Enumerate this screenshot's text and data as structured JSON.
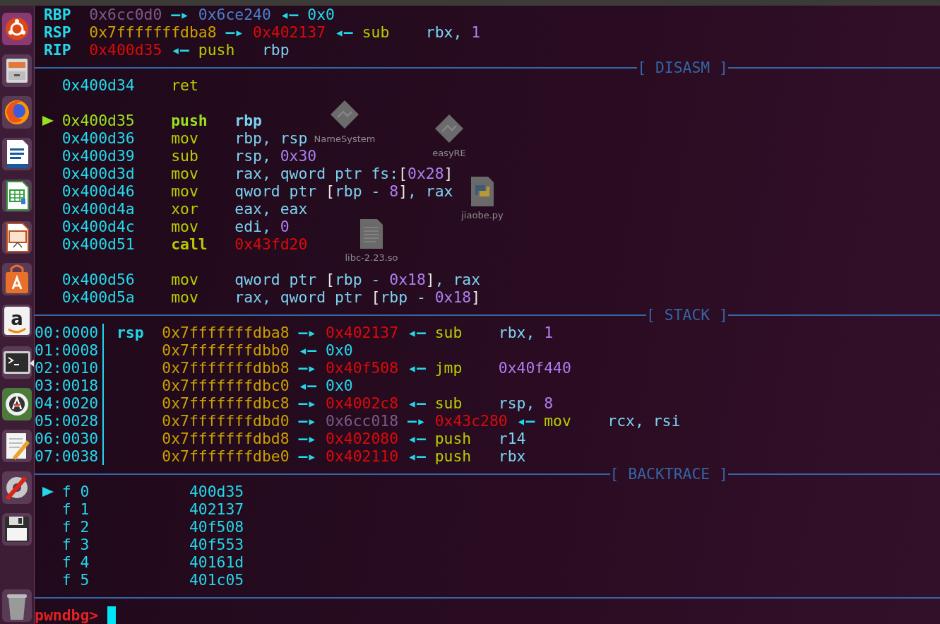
{
  "launcher": [
    {
      "kind": "ubuntu",
      "focused": false
    },
    {
      "kind": "files",
      "focused": false
    },
    {
      "kind": "browser",
      "focused": false
    },
    {
      "kind": "writer",
      "focused": false
    },
    {
      "kind": "calc",
      "focused": false
    },
    {
      "kind": "impress",
      "focused": false
    },
    {
      "kind": "software",
      "focused": false
    },
    {
      "kind": "amazon",
      "glyph": "a",
      "focused": false
    },
    {
      "kind": "terminal",
      "focused": true
    },
    {
      "kind": "updater",
      "focused": false
    },
    {
      "kind": "editor",
      "focused": false
    },
    {
      "kind": "settings",
      "focused": false
    },
    {
      "kind": "disk",
      "focused": false
    },
    {
      "kind": "trash",
      "focused": false
    }
  ],
  "desktop_icons": [
    {
      "label": "NameSystem",
      "kind": "executable"
    },
    {
      "label": "easyRE",
      "kind": "executable"
    },
    {
      "label": "jiaobe.py",
      "kind": "python"
    },
    {
      "label": "libc-2.23.so",
      "kind": "document"
    }
  ],
  "registers": [
    {
      "name": "RBP",
      "tokens": [
        {
          "text": "0x6cc0d0",
          "kind": "rodata"
        },
        {
          "text": "—▸",
          "kind": "arrow"
        },
        {
          "text": "0x6ce240",
          "kind": "heap"
        },
        {
          "text": "◂—",
          "kind": "arrow"
        },
        {
          "text": "0x0",
          "kind": "plain"
        }
      ]
    },
    {
      "name": "RSP",
      "tokens": [
        {
          "text": "0x7fffffffdba8",
          "kind": "stack"
        },
        {
          "text": "—▸",
          "kind": "arrow"
        },
        {
          "text": "0x402137",
          "kind": "code"
        },
        {
          "text": "◂—",
          "kind": "arrow"
        },
        {
          "text": "sub",
          "kind": "op"
        },
        {
          "text": "rbx, ",
          "kind": "reg"
        },
        {
          "text": "1",
          "kind": "num"
        }
      ]
    },
    {
      "name": "RIP",
      "tokens": [
        {
          "text": "0x400d35",
          "kind": "code"
        },
        {
          "text": "◂—",
          "kind": "arrow"
        },
        {
          "text": "push",
          "kind": "op"
        },
        {
          "text": "rbp",
          "kind": "reg"
        }
      ]
    }
  ],
  "disasm": {
    "title": "[ DISASM ]",
    "rows": [
      {
        "address": "0x400d34",
        "mnemonic": "ret",
        "selected": false,
        "branch": false,
        "blank_before": false,
        "operands": []
      },
      {
        "address": "0x400d35",
        "mnemonic": "push",
        "selected": true,
        "branch": false,
        "blank_before": true,
        "operands": [
          {
            "text": "rbp",
            "kind": "reg"
          }
        ]
      },
      {
        "address": "0x400d36",
        "mnemonic": "mov",
        "selected": false,
        "branch": false,
        "blank_before": false,
        "operands": [
          {
            "text": "rbp, rsp",
            "kind": "reg"
          }
        ]
      },
      {
        "address": "0x400d39",
        "mnemonic": "sub",
        "selected": false,
        "branch": false,
        "blank_before": false,
        "operands": [
          {
            "text": "rsp, ",
            "kind": "reg"
          },
          {
            "text": "0x30",
            "kind": "num"
          }
        ]
      },
      {
        "address": "0x400d3d",
        "mnemonic": "mov",
        "selected": false,
        "branch": false,
        "blank_before": false,
        "operands": [
          {
            "text": "rax, qword ptr fs:",
            "kind": "reg"
          },
          {
            "text": "[",
            "kind": "bracket"
          },
          {
            "text": "0x28",
            "kind": "num"
          },
          {
            "text": "]",
            "kind": "bracket"
          }
        ]
      },
      {
        "address": "0x400d46",
        "mnemonic": "mov",
        "selected": false,
        "branch": false,
        "blank_before": false,
        "operands": [
          {
            "text": "qword ptr ",
            "kind": "reg"
          },
          {
            "text": "[",
            "kind": "bracket"
          },
          {
            "text": "rbp - ",
            "kind": "reg"
          },
          {
            "text": "8",
            "kind": "num"
          },
          {
            "text": "]",
            "kind": "bracket"
          },
          {
            "text": ", rax",
            "kind": "reg"
          }
        ]
      },
      {
        "address": "0x400d4a",
        "mnemonic": "xor",
        "selected": false,
        "branch": false,
        "blank_before": false,
        "operands": [
          {
            "text": "eax, eax",
            "kind": "reg"
          }
        ]
      },
      {
        "address": "0x400d4c",
        "mnemonic": "mov",
        "selected": false,
        "branch": false,
        "blank_before": false,
        "operands": [
          {
            "text": "edi, ",
            "kind": "reg"
          },
          {
            "text": "0",
            "kind": "num"
          }
        ]
      },
      {
        "address": "0x400d51",
        "mnemonic": "call",
        "selected": false,
        "branch": true,
        "blank_before": false,
        "operands": [
          {
            "text": "0x43fd20",
            "kind": "code"
          }
        ]
      },
      {
        "address": "0x400d56",
        "mnemonic": "mov",
        "selected": false,
        "branch": false,
        "blank_before": true,
        "operands": [
          {
            "text": "qword ptr ",
            "kind": "reg"
          },
          {
            "text": "[",
            "kind": "bracket"
          },
          {
            "text": "rbp - ",
            "kind": "reg"
          },
          {
            "text": "0x18",
            "kind": "num"
          },
          {
            "text": "]",
            "kind": "bracket"
          },
          {
            "text": ", rax",
            "kind": "reg"
          }
        ]
      },
      {
        "address": "0x400d5a",
        "mnemonic": "mov",
        "selected": false,
        "branch": false,
        "blank_before": false,
        "operands": [
          {
            "text": "rax, qword ptr ",
            "kind": "reg"
          },
          {
            "text": "[",
            "kind": "bracket"
          },
          {
            "text": "rbp - ",
            "kind": "reg"
          },
          {
            "text": "0x18",
            "kind": "num"
          },
          {
            "text": "]",
            "kind": "bracket"
          }
        ]
      }
    ]
  },
  "stack": {
    "title": "[ STACK ]",
    "rows": [
      {
        "offset": "00:0000",
        "register": "rsp",
        "tokens": [
          {
            "text": "0x7fffffffdba8",
            "kind": "stack"
          },
          {
            "text": "—▸",
            "kind": "arrow"
          },
          {
            "text": "0x402137",
            "kind": "code"
          },
          {
            "text": "◂—",
            "kind": "arrow"
          },
          {
            "text": "sub",
            "kind": "op"
          },
          {
            "text": "rbx, ",
            "kind": "reg"
          },
          {
            "text": "1",
            "kind": "num"
          }
        ]
      },
      {
        "offset": "01:0008",
        "tokens": [
          {
            "text": "0x7fffffffdbb0",
            "kind": "stack"
          },
          {
            "text": "◂—",
            "kind": "arrow"
          },
          {
            "text": "0x0",
            "kind": "plain"
          }
        ]
      },
      {
        "offset": "02:0010",
        "tokens": [
          {
            "text": "0x7fffffffdbb8",
            "kind": "stack"
          },
          {
            "text": "—▸",
            "kind": "arrow"
          },
          {
            "text": "0x40f508",
            "kind": "code"
          },
          {
            "text": "◂—",
            "kind": "arrow"
          },
          {
            "text": "jmp",
            "kind": "op"
          },
          {
            "text": "0x40f440",
            "kind": "num"
          }
        ]
      },
      {
        "offset": "03:0018",
        "tokens": [
          {
            "text": "0x7fffffffdbc0",
            "kind": "stack"
          },
          {
            "text": "◂—",
            "kind": "arrow"
          },
          {
            "text": "0x0",
            "kind": "plain"
          }
        ]
      },
      {
        "offset": "04:0020",
        "tokens": [
          {
            "text": "0x7fffffffdbc8",
            "kind": "stack"
          },
          {
            "text": "—▸",
            "kind": "arrow"
          },
          {
            "text": "0x4002c8",
            "kind": "code"
          },
          {
            "text": "◂—",
            "kind": "arrow"
          },
          {
            "text": "sub",
            "kind": "op"
          },
          {
            "text": "rsp, ",
            "kind": "reg"
          },
          {
            "text": "8",
            "kind": "num"
          }
        ]
      },
      {
        "offset": "05:0028",
        "tokens": [
          {
            "text": "0x7fffffffdbd0",
            "kind": "stack"
          },
          {
            "text": "—▸",
            "kind": "arrow"
          },
          {
            "text": "0x6cc018",
            "kind": "rodata"
          },
          {
            "text": "—▸",
            "kind": "arrow"
          },
          {
            "text": "0x43c280",
            "kind": "code"
          },
          {
            "text": "◂—",
            "kind": "arrow"
          },
          {
            "text": "mov",
            "kind": "op"
          },
          {
            "text": "rcx, rsi",
            "kind": "reg"
          }
        ]
      },
      {
        "offset": "06:0030",
        "tokens": [
          {
            "text": "0x7fffffffdbd8",
            "kind": "stack"
          },
          {
            "text": "—▸",
            "kind": "arrow"
          },
          {
            "text": "0x402080",
            "kind": "code"
          },
          {
            "text": "◂—",
            "kind": "arrow"
          },
          {
            "text": "push",
            "kind": "op"
          },
          {
            "text": "r14",
            "kind": "reg"
          }
        ]
      },
      {
        "offset": "07:0038",
        "tokens": [
          {
            "text": "0x7fffffffdbe0",
            "kind": "stack"
          },
          {
            "text": "—▸",
            "kind": "arrow"
          },
          {
            "text": "0x402110",
            "kind": "code"
          },
          {
            "text": "◂—",
            "kind": "arrow"
          },
          {
            "text": "push",
            "kind": "op"
          },
          {
            "text": "rbx",
            "kind": "reg"
          }
        ]
      }
    ]
  },
  "backtrace": {
    "title": "[ BACKTRACE ]",
    "frames": [
      {
        "frame": "f 0",
        "address": "400d35",
        "selected": true
      },
      {
        "frame": "f 1",
        "address": "402137",
        "selected": false
      },
      {
        "frame": "f 2",
        "address": "40f508",
        "selected": false
      },
      {
        "frame": "f 3",
        "address": "40f553",
        "selected": false
      },
      {
        "frame": "f 4",
        "address": "40161d",
        "selected": false
      },
      {
        "frame": "f 5",
        "address": "401c05",
        "selected": false
      }
    ]
  },
  "prompt": "pwndbg>"
}
